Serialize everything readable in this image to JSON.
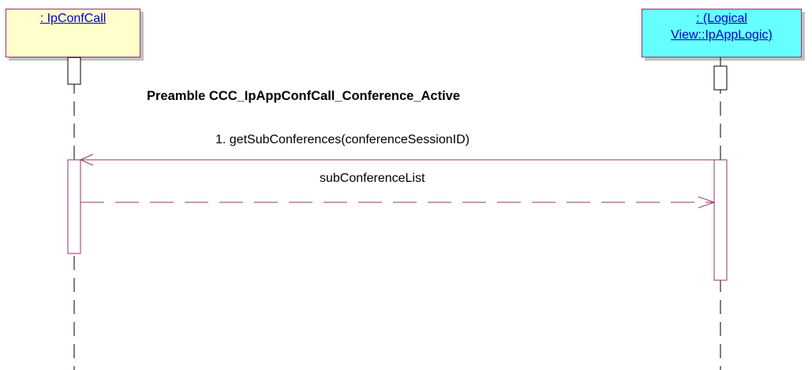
{
  "participants": [
    {
      "label": ": IpConfCall",
      "fill": "#ffffcc"
    },
    {
      "label_line1": ": (Logical ",
      "label_line2": "View::IpAppLogic)",
      "fill": "#66ffff"
    }
  ],
  "preamble": "Preamble CCC_IpAppConfCall_Conference_Active",
  "messages": [
    {
      "label": "1. getSubConferences(conferenceSessionID)",
      "kind": "call",
      "from": "View::IpAppLogic",
      "to": "IpConfCall"
    },
    {
      "label": "subConferenceList",
      "kind": "return",
      "from": "IpConfCall",
      "to": "View::IpAppLogic"
    }
  ],
  "colors": {
    "line": "#993366",
    "lifeline": "#000000",
    "link_text": "#0000cc"
  }
}
